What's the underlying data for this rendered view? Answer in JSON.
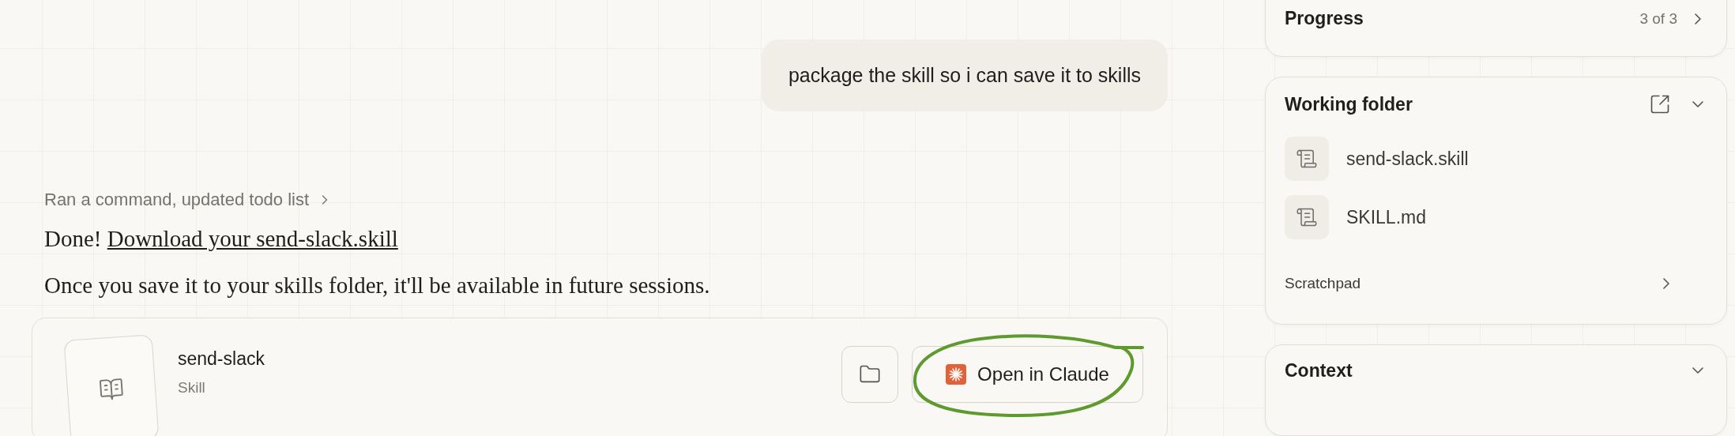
{
  "user_message": "package the skill so i can save it to skills",
  "tool_summary": {
    "label": "Ran a command, updated todo list",
    "expanded": false
  },
  "response": {
    "lead": "Done!",
    "link": "Download your send-slack.skill",
    "paragraph": "Once you save it to your skills folder, it'll be available in future sessions."
  },
  "artifact": {
    "name": "send-slack",
    "type": "Skill",
    "open_button": {
      "label": "Open in Claude",
      "circled": true
    }
  },
  "sidebar": {
    "progress": {
      "title": "Progress",
      "count": "3 of 3"
    },
    "working_folder": {
      "title": "Working folder",
      "expanded": true,
      "files": [
        "send-slack.skill",
        "SKILL.md"
      ],
      "scratchpad": "Scratchpad"
    },
    "context": {
      "title": "Context",
      "expanded": true
    }
  }
}
